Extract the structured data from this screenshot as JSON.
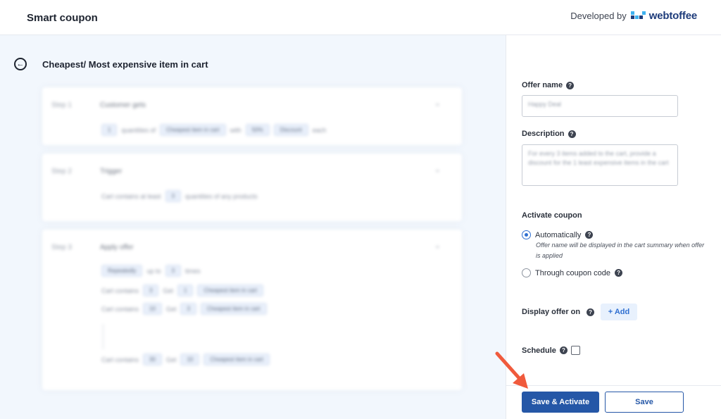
{
  "header": {
    "title": "Smart coupon",
    "developed_by": "Developed by",
    "brand": "webtoffee"
  },
  "main": {
    "back_icon": "arrow-left-circle-icon",
    "page_title": "Cheapest/ Most expensive item in cart",
    "steps": [
      {
        "number": "Step 1",
        "title": "Customer gets",
        "rows": [
          [
            "1",
            "quantities of",
            "Cheapest item in cart",
            "with",
            "50%",
            "Discount",
            "each"
          ]
        ]
      },
      {
        "number": "Step 2",
        "title": "Trigger",
        "rows": [
          [
            "Cart contains at least",
            "3",
            "quantities of any products"
          ]
        ]
      },
      {
        "number": "Step 3",
        "title": "Apply offer",
        "rows": [
          [
            "Repeatedly",
            "up to",
            "3",
            "times"
          ],
          [
            "Cart contains",
            "3",
            "Get",
            "1",
            "Cheapest item in cart"
          ],
          [
            "Cart contains",
            "10",
            "Get",
            "3",
            "Cheapest item in cart"
          ],
          [
            "Cart contains",
            "30",
            "Get",
            "10",
            "Cheapest item in cart"
          ]
        ]
      }
    ]
  },
  "sidebar": {
    "offer_name": {
      "label": "Offer name",
      "value": "Happy Deal"
    },
    "description": {
      "label": "Description",
      "value": "For every 3 items added to the cart, provide a discount for the 1 least expensive items in the cart"
    },
    "activate": {
      "label": "Activate coupon",
      "options": [
        {
          "label": "Automatically",
          "selected": true,
          "description": "Offer name will be displayed in the cart summary when offer is applied"
        },
        {
          "label": "Through coupon code",
          "selected": false
        }
      ]
    },
    "display_offer": {
      "label": "Display offer on",
      "button": "+ Add"
    },
    "schedule": {
      "label": "Schedule",
      "checked": false
    },
    "footer": {
      "primary": "Save & Activate",
      "secondary": "Save"
    }
  },
  "colors": {
    "primary": "#2557a7",
    "accent": "#2f6fd1",
    "arrow": "#f05a3c"
  }
}
